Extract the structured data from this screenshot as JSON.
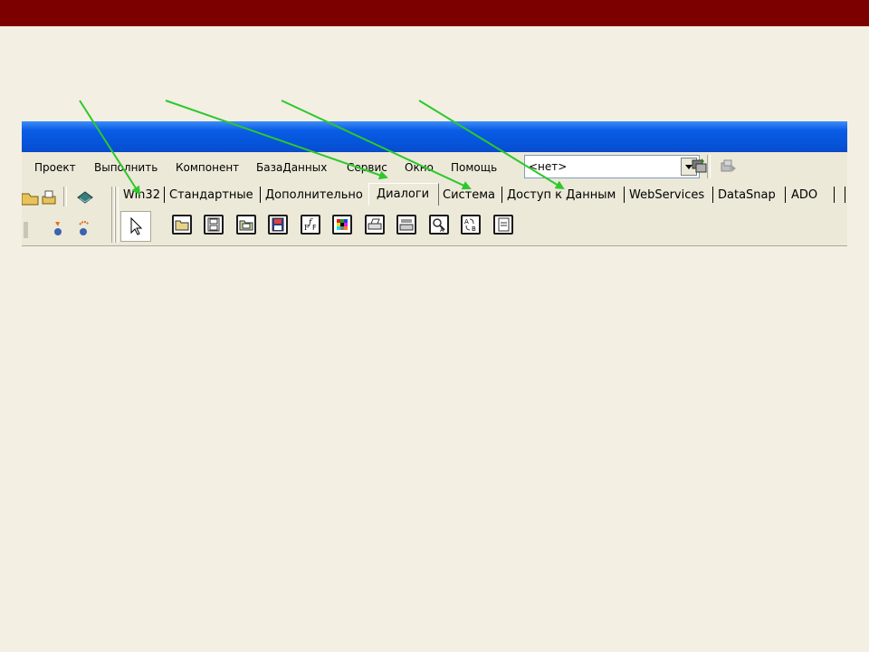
{
  "menu": {
    "items": [
      "Проект",
      "Выполнить",
      "Компонент",
      "БазаДанных",
      "Сервис",
      "Окно",
      "Помощь"
    ]
  },
  "toolbar": {
    "combo_value": "<нет>"
  },
  "palette": {
    "tabs": [
      "Win32",
      "Стандартные",
      "Дополнительно",
      "Диалоги",
      "Система",
      "Доступ к Данным",
      "WebServices",
      "DataSnap",
      "ADO"
    ],
    "selected_tab": "Диалоги",
    "components": [
      "pointer",
      "open-dialog",
      "save-dialog",
      "open-picture-dialog",
      "save-picture-dialog",
      "font-dialog",
      "color-dialog",
      "print-dialog",
      "printer-setup-dialog",
      "find-dialog",
      "replace-dialog",
      "page-setup-dialog"
    ]
  },
  "colors": {
    "page_background": "#F3EFE2",
    "top_bar": "#7D0000",
    "title_bar": "#0553D8",
    "arrow": "#2DC82D"
  }
}
